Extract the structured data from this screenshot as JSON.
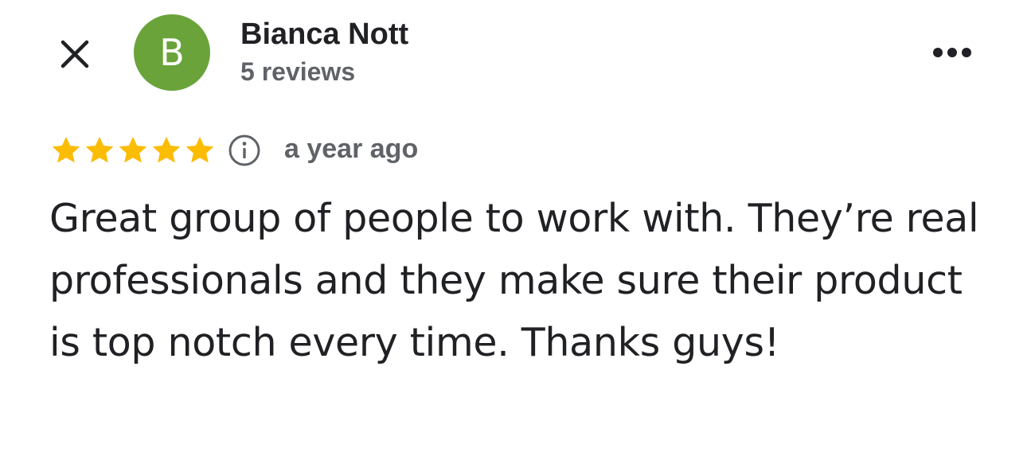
{
  "reviewer": {
    "initial": "B",
    "name": "Bianca Nott",
    "review_count": "5 reviews",
    "avatar_color": "#6aa33a"
  },
  "review": {
    "rating": 5,
    "rating_max": 5,
    "star_color": "#fbbc04",
    "timestamp": "a year ago",
    "text": "Great group of people to work with. They’re real professionals and they make sure their product is top notch every time. Thanks guys!"
  },
  "icons": {
    "close": "close-icon",
    "more": "more-horizontal-icon",
    "info": "info-icon",
    "star": "star-icon"
  }
}
